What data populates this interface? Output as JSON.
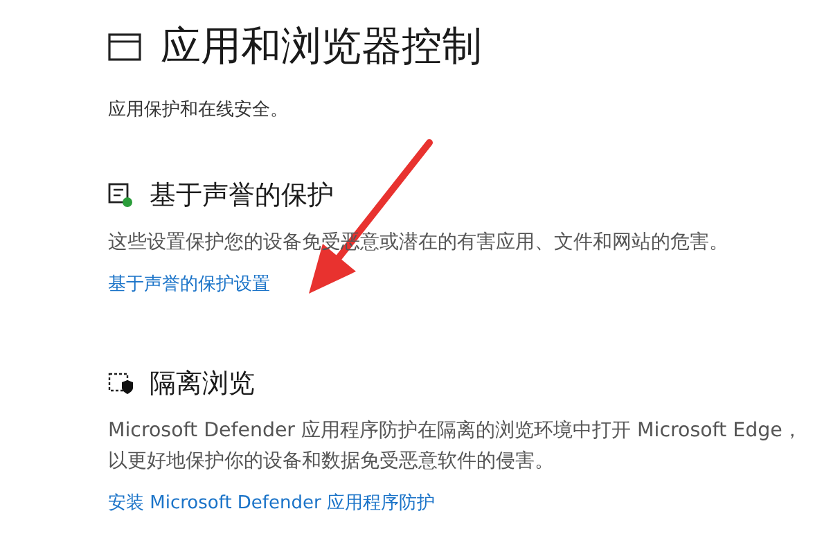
{
  "page": {
    "title": "应用和浏览器控制",
    "subtitle": "应用保护和在线安全。"
  },
  "sections": [
    {
      "kind": "reputation",
      "heading": "基于声誉的保护",
      "description": "这些设置保护您的设备免受恶意或潜在的有害应用、文件和网站的危害。",
      "link": "基于声誉的保护设置"
    },
    {
      "kind": "isolated",
      "heading": "隔离浏览",
      "description": "Microsoft Defender 应用程序防护在隔离的浏览环境中打开 Microsoft Edge，以更好地保护你的设备和数据免受恶意软件的侵害。",
      "link": "安装 Microsoft Defender 应用程序防护"
    }
  ]
}
